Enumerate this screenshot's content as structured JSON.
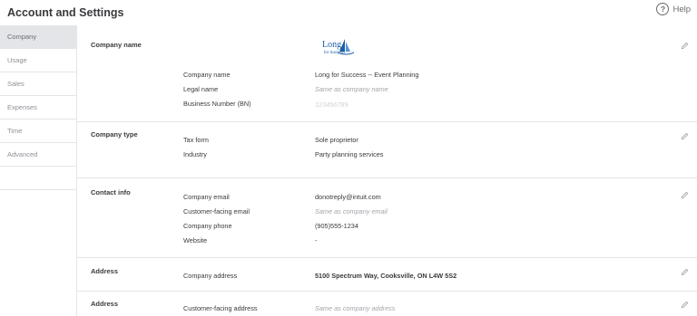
{
  "header": {
    "title": "Account and Settings",
    "help_label": "Help",
    "help_icon": "?"
  },
  "sidebar": {
    "items": [
      {
        "label": "Company",
        "active": true
      },
      {
        "label": "Usage"
      },
      {
        "label": "Sales"
      },
      {
        "label": "Expenses"
      },
      {
        "label": "Time"
      },
      {
        "label": "Advanced"
      }
    ]
  },
  "company_name": {
    "section_label": "Company name",
    "logo": {
      "line1": "Long",
      "line2": "for Success"
    },
    "rows": [
      {
        "label": "Company name",
        "value": "Long for Success -- Event Planning"
      },
      {
        "label": "Legal name",
        "value": "Same as company name"
      },
      {
        "label": "Business Number (BN)",
        "value": "123456789"
      }
    ]
  },
  "company_type": {
    "section_label": "Company type",
    "rows": [
      {
        "label": "Tax form",
        "value": "Sole proprietor"
      },
      {
        "label": "Industry",
        "value": "Party planning services"
      }
    ]
  },
  "contact_info": {
    "section_label": "Contact info",
    "rows": [
      {
        "label": "Company email",
        "value": "donotreply@intuit.com"
      },
      {
        "label": "Customer-facing email",
        "value": "Same as company email"
      },
      {
        "label": "Company phone",
        "value": "(905)555-1234"
      },
      {
        "label": "Website",
        "value": "-"
      }
    ]
  },
  "address": {
    "section_label": "Address",
    "rows": [
      {
        "label": "Company address",
        "value": "5100 Spectrum Way, Cooksville, ON L4W 5S2"
      }
    ]
  },
  "address2": {
    "section_label": "Address",
    "rows": [
      {
        "label": "Customer-facing address",
        "value": "Same as company address"
      }
    ]
  },
  "colors": {
    "sidebar_active_bg": "#e3e5e8",
    "text": "#393a3d",
    "muted": "#a3a5aa",
    "logo_blue": "#1b5fa8"
  }
}
